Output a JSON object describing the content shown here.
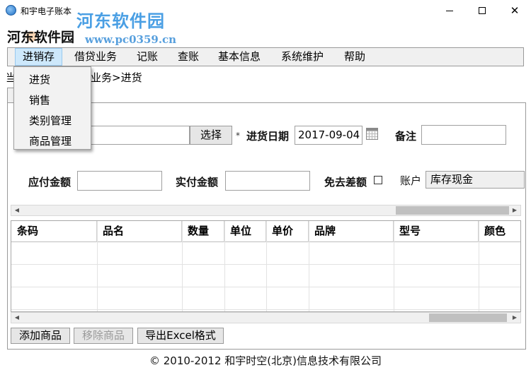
{
  "window": {
    "title": "和宇电子账本",
    "watermark": "河东软件园",
    "watermark_url": "www.pc0359.cn",
    "brand": "河东软件园"
  },
  "menu": [
    "进销存",
    "借贷业务",
    "记账",
    "查账",
    "基本信息",
    "系统维护",
    "帮助"
  ],
  "dropdown": [
    "进货",
    "销售",
    "类别管理",
    "商品管理"
  ],
  "breadcrumb": {
    "left": "当",
    "right": "业务>进货"
  },
  "form": {
    "select_button": "选择",
    "required_mark": "*",
    "date_label": "进货日期",
    "date_value": "2017-09-04",
    "remark_label": "备注",
    "payable_label": "应付金额",
    "paid_label": "实付金额",
    "waive_label": "免去差额",
    "account_label": "账户",
    "account_value": "库存现金"
  },
  "grid": {
    "columns": [
      "条码",
      "品名",
      "数量",
      "单位",
      "单价",
      "品牌",
      "型号",
      "颜色"
    ]
  },
  "buttons": {
    "add": "添加商品",
    "remove": "移除商品",
    "export": "导出Excel格式"
  },
  "footer": "© 2010-2012  和宇时空(北京)信息技术有限公司",
  "colors": {
    "menu_active": "#cde8fb",
    "watermark": "#2b8fe0"
  }
}
